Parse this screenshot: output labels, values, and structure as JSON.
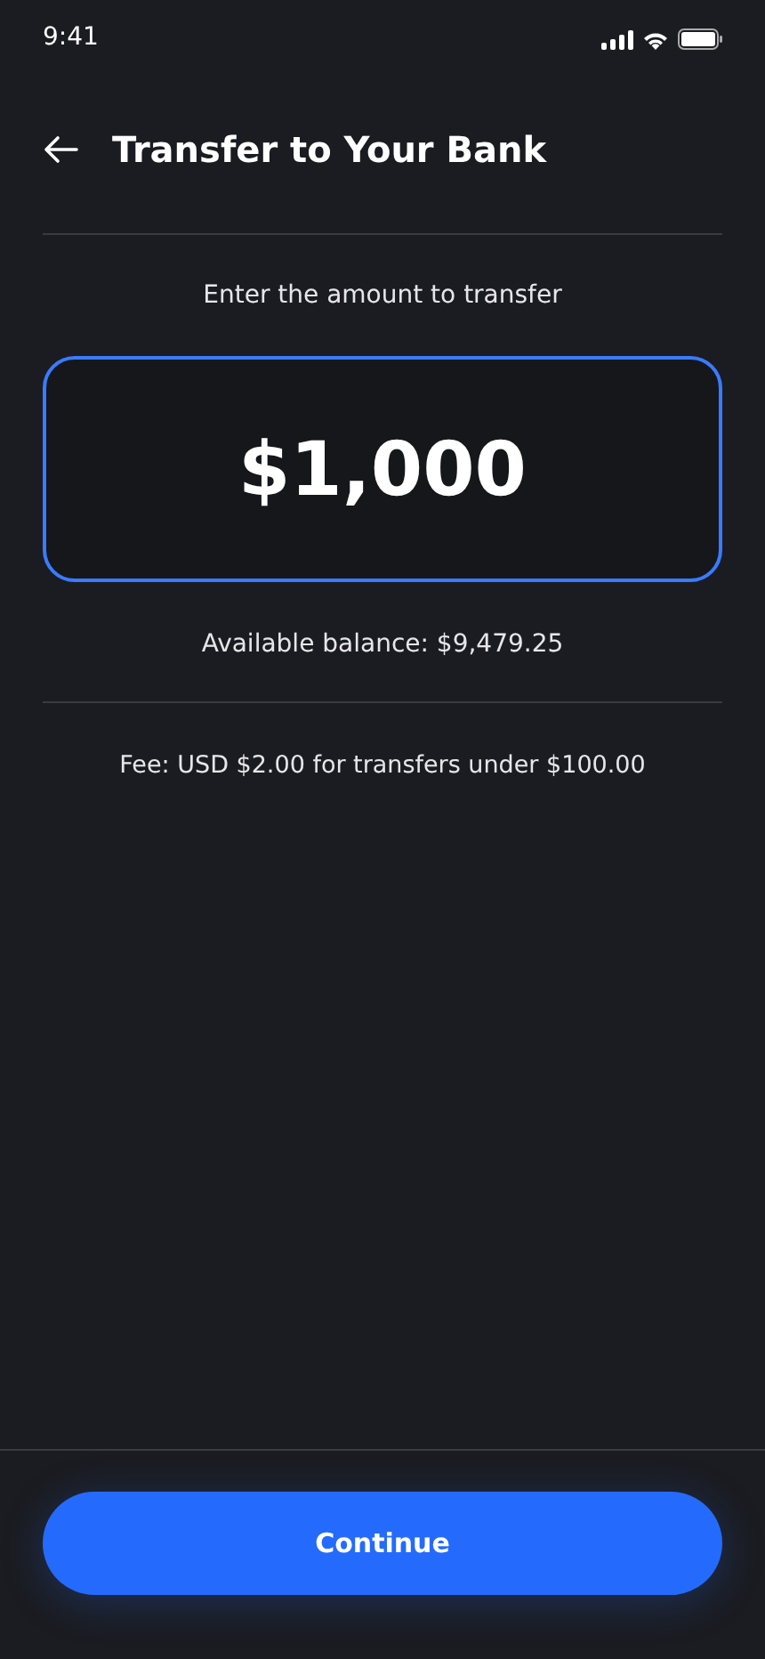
{
  "status_bar": {
    "time": "9:41"
  },
  "header": {
    "title": "Transfer to Your Bank"
  },
  "amount": {
    "label": "Enter the amount to transfer",
    "value": "$1,000",
    "focused": true
  },
  "available_balance": "Available balance: $9,479.25",
  "fee_note": "Fee: USD $2.00 for transfers under $100.00",
  "primary_button": "Continue"
}
